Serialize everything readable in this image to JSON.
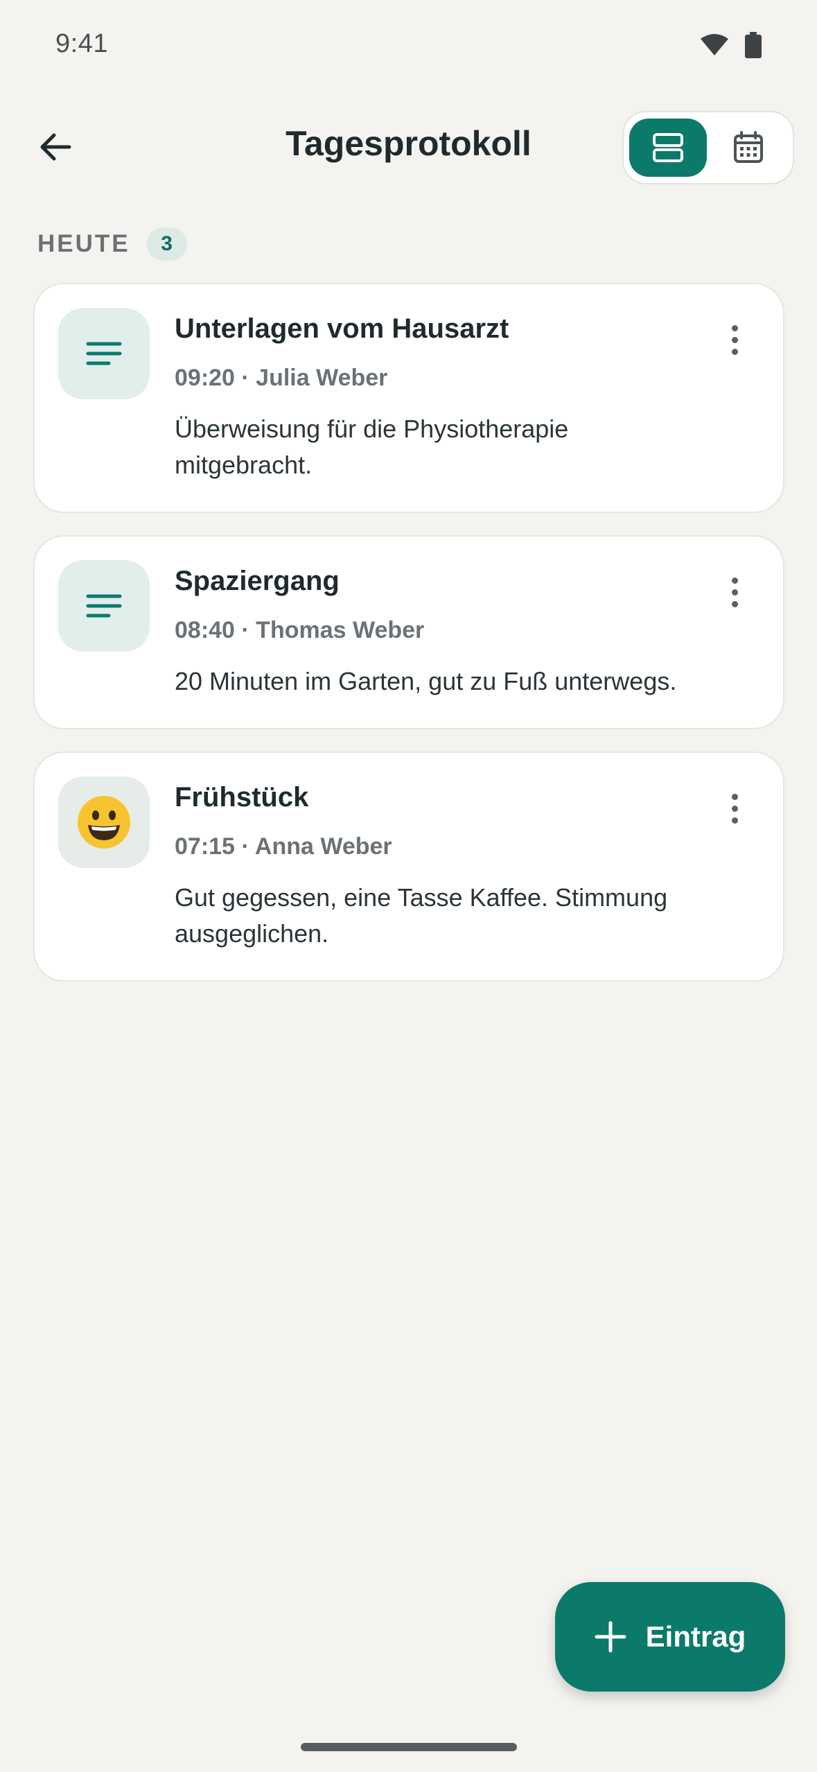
{
  "status_bar": {
    "time": "9:41",
    "wifi_icon": "wifi-icon",
    "battery_icon": "battery-icon"
  },
  "header": {
    "title": "Tagesprotokoll",
    "back_icon": "arrow-left-icon",
    "view_toggle": {
      "selected": "list",
      "options": [
        "list-view-icon",
        "calendar-icon"
      ]
    }
  },
  "section": {
    "label": "HEUTE",
    "count": "3"
  },
  "entries": [
    {
      "icon": "notes-icon",
      "title": "Unterlagen vom Hausarzt",
      "meta": "09:20 · Julia Weber",
      "note": "Überweisung für die Physiotherapie mitgebracht."
    },
    {
      "icon": "notes-icon",
      "title": "Spaziergang",
      "meta": "08:40 · Thomas Weber",
      "note": "20 Minuten im Garten, gut zu Fuß unterwegs."
    },
    {
      "icon": "smiley-icon",
      "title": "Frühstück",
      "meta": "07:15 · Anna Weber",
      "note": "Gut gegessen, eine Tasse Kaffee. Stimmung ausgeglichen."
    }
  ],
  "fab": {
    "label": "Eintrag",
    "icon": "plus-icon"
  },
  "colors": {
    "accent": "#0B7A6B",
    "background": "#F4F3EF",
    "card": "#FFFFFF"
  }
}
